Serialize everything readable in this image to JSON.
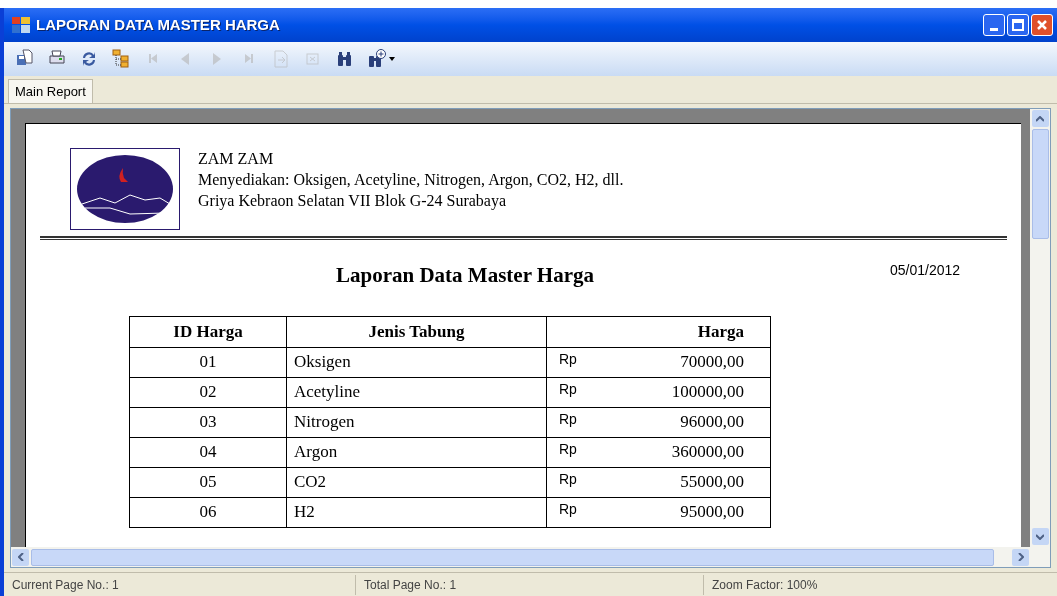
{
  "window": {
    "title": "LAPORAN DATA MASTER HARGA"
  },
  "toolbar": [
    {
      "kind": "export",
      "disabled": false
    },
    {
      "kind": "print",
      "disabled": false
    },
    {
      "kind": "refresh",
      "disabled": false
    },
    {
      "kind": "tree",
      "disabled": false
    },
    {
      "kind": "first",
      "disabled": true
    },
    {
      "kind": "prev",
      "disabled": true
    },
    {
      "kind": "next",
      "disabled": true
    },
    {
      "kind": "last",
      "disabled": true
    },
    {
      "kind": "goto",
      "disabled": true
    },
    {
      "kind": "stop",
      "disabled": true
    },
    {
      "kind": "find",
      "disabled": false
    },
    {
      "kind": "zoom",
      "disabled": false
    }
  ],
  "tabs": [
    {
      "label": "Main Report",
      "selected": true
    }
  ],
  "report": {
    "company": "ZAM ZAM",
    "tagline": "Menyediakan: Oksigen, Acetyline, Nitrogen, Argon, CO2, H2, dll.",
    "address": "Griya Kebraon Selatan VII Blok G-24 Surabaya",
    "title": "Laporan Data Master Harga",
    "date": "05/01/2012",
    "columns": [
      "ID Harga",
      "Jenis Tabung",
      "Harga"
    ],
    "rows": [
      {
        "id": "01",
        "jenis": "Oksigen",
        "currency": "Rp",
        "harga": "70000,00"
      },
      {
        "id": "02",
        "jenis": "Acetyline",
        "currency": "Rp",
        "harga": "100000,00"
      },
      {
        "id": "03",
        "jenis": "Nitrogen",
        "currency": "Rp",
        "harga": "96000,00"
      },
      {
        "id": "04",
        "jenis": "Argon",
        "currency": "Rp",
        "harga": "360000,00"
      },
      {
        "id": "05",
        "jenis": "CO2",
        "currency": "Rp",
        "harga": "55000,00"
      },
      {
        "id": "06",
        "jenis": "H2",
        "currency": "Rp",
        "harga": "95000,00"
      }
    ]
  },
  "status_bar": [
    "Current Page No.: 1",
    "Total Page No.: 1",
    "Zoom Factor: 100%"
  ]
}
